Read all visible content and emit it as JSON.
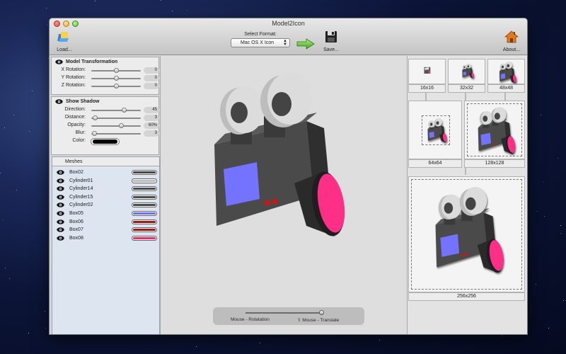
{
  "window": {
    "title": "Model2Icon"
  },
  "toolbar": {
    "load_label": "Load...",
    "select_format_label": "Select Format:",
    "format_value": "Mac OS X Icon",
    "save_label": "Save...",
    "about_label": "About..."
  },
  "model_transformation": {
    "title": "Model Transformation",
    "rows": [
      {
        "label": "X Rotation:",
        "value": "0",
        "slider": 0.5
      },
      {
        "label": "Y Rotation:",
        "value": "0",
        "slider": 0.5
      },
      {
        "label": "Z Rotation:",
        "value": "0",
        "slider": 0.5
      }
    ]
  },
  "shadow": {
    "title": "Show Shadow",
    "rows": [
      {
        "label": "Direction:",
        "value": "45",
        "slider": 0.65
      },
      {
        "label": "Distance:",
        "value": "3",
        "slider": 0.07
      },
      {
        "label": "Opacity:",
        "value": "60%",
        "slider": 0.6
      },
      {
        "label": "Blur:",
        "value": "3",
        "slider": 0.05
      }
    ],
    "color_label": "Color:",
    "color": "#000000"
  },
  "meshes": {
    "title": "Meshes",
    "items": [
      {
        "name": "Box02",
        "color": "#454545"
      },
      {
        "name": "Cylinder01",
        "color": "#bdbdbd"
      },
      {
        "name": "Cylinder14",
        "color": "#4a4a4a"
      },
      {
        "name": "Cylinder15",
        "color": "#4a4a4a"
      },
      {
        "name": "Cylinder02",
        "color": "#4a4a4a"
      },
      {
        "name": "Box05",
        "color": "#6e6ef0"
      },
      {
        "name": "Box06",
        "color": "#a21616"
      },
      {
        "name": "Box07",
        "color": "#a21616"
      },
      {
        "name": "Box08",
        "color": "#e8306a"
      }
    ]
  },
  "viewport": {
    "hud_left": "Mouse - Rotatation",
    "hud_right": "Mouse - Translate",
    "hud_slider": 0.97
  },
  "previews": {
    "sizes": [
      "16x16",
      "32x32",
      "48x48",
      "64x64",
      "128x128",
      "256x256"
    ]
  },
  "colors": {
    "body": "#4a4a4a",
    "body_dark": "#2f2f2f",
    "reel": "#dcdcdc",
    "screen": "#7373ff",
    "lens": "#ff2f88",
    "button_red": "#cc1616"
  }
}
